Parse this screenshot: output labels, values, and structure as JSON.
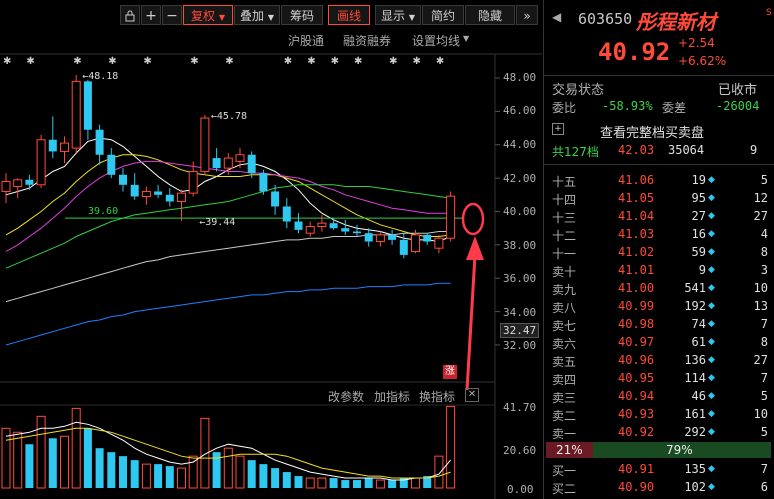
{
  "toolbar": {
    "buttons": [
      {
        "label": "复权",
        "active": true,
        "has_dropdown": true
      },
      {
        "label": "叠加",
        "active": false,
        "has_dropdown": true
      },
      {
        "label": "筹码",
        "active": false,
        "has_dropdown": false
      },
      {
        "label": "画线",
        "active": true,
        "has_dropdown": false
      },
      {
        "label": "显示",
        "active": false,
        "has_dropdown": true
      },
      {
        "label": "简约",
        "active": false,
        "has_dropdown": false
      },
      {
        "label": "隐藏",
        "active": false,
        "has_dropdown": false
      }
    ],
    "icons": [
      "lock-icon",
      "plus-icon",
      "minus-icon",
      "double-chevron-right-icon"
    ]
  },
  "sub_toolbar": {
    "links": [
      "沪股通",
      "融资融券",
      "设置均线"
    ]
  },
  "indicator_toolbar": {
    "links": [
      "改参数",
      "加指标",
      "换指标"
    ],
    "close_icon": "close-icon"
  },
  "chart_data": {
    "type": "candlestick",
    "y_axis_ticks": [
      "48.00",
      "46.00",
      "44.00",
      "42.00",
      "40.00",
      "38.00",
      "36.00",
      "34.00",
      "32.00"
    ],
    "current_price_tag": "32.47",
    "annotations": [
      {
        "text": "48.18",
        "x_index": 6,
        "value": 48.18
      },
      {
        "text": "45.78",
        "x_index": 17,
        "value": 45.78
      },
      {
        "text": "39.60",
        "x_index": 6,
        "value": 39.6
      },
      {
        "text": "39.44",
        "x_index": 16,
        "value": 39.44
      }
    ],
    "limit_up_badge": "涨",
    "horizontal_line_value": 39.6,
    "candles": [
      {
        "o": 41.2,
        "h": 42.3,
        "l": 40.5,
        "c": 41.8
      },
      {
        "o": 41.5,
        "h": 42.0,
        "l": 40.8,
        "c": 41.9
      },
      {
        "o": 41.9,
        "h": 42.2,
        "l": 41.3,
        "c": 41.6
      },
      {
        "o": 41.6,
        "h": 44.6,
        "l": 41.4,
        "c": 44.3
      },
      {
        "o": 44.3,
        "h": 45.7,
        "l": 43.2,
        "c": 43.6
      },
      {
        "o": 43.6,
        "h": 44.5,
        "l": 42.9,
        "c": 44.1
      },
      {
        "o": 43.8,
        "h": 48.18,
        "l": 43.5,
        "c": 47.8
      },
      {
        "o": 47.8,
        "h": 47.9,
        "l": 44.3,
        "c": 44.9
      },
      {
        "o": 44.9,
        "h": 45.2,
        "l": 42.8,
        "c": 43.4
      },
      {
        "o": 43.4,
        "h": 43.8,
        "l": 42.0,
        "c": 42.2
      },
      {
        "o": 42.2,
        "h": 42.6,
        "l": 41.2,
        "c": 41.6
      },
      {
        "o": 41.6,
        "h": 42.3,
        "l": 40.7,
        "c": 40.9
      },
      {
        "o": 40.9,
        "h": 41.5,
        "l": 40.4,
        "c": 41.2
      },
      {
        "o": 41.2,
        "h": 41.6,
        "l": 40.8,
        "c": 41.0
      },
      {
        "o": 41.0,
        "h": 41.4,
        "l": 40.3,
        "c": 40.6
      },
      {
        "o": 40.6,
        "h": 41.3,
        "l": 39.44,
        "c": 41.1
      },
      {
        "o": 41.1,
        "h": 43.0,
        "l": 40.9,
        "c": 42.4
      },
      {
        "o": 42.4,
        "h": 45.78,
        "l": 42.2,
        "c": 45.6
      },
      {
        "o": 43.2,
        "h": 43.8,
        "l": 42.4,
        "c": 42.6
      },
      {
        "o": 42.6,
        "h": 43.5,
        "l": 42.2,
        "c": 43.2
      },
      {
        "o": 43.0,
        "h": 43.8,
        "l": 42.6,
        "c": 43.4
      },
      {
        "o": 43.4,
        "h": 43.6,
        "l": 42.0,
        "c": 42.3
      },
      {
        "o": 42.3,
        "h": 42.5,
        "l": 41.0,
        "c": 41.2
      },
      {
        "o": 41.2,
        "h": 41.6,
        "l": 39.8,
        "c": 40.3
      },
      {
        "o": 40.3,
        "h": 40.8,
        "l": 39.0,
        "c": 39.4
      },
      {
        "o": 39.4,
        "h": 39.9,
        "l": 38.7,
        "c": 38.9
      },
      {
        "o": 38.7,
        "h": 39.4,
        "l": 38.5,
        "c": 39.1
      },
      {
        "o": 39.1,
        "h": 39.8,
        "l": 38.8,
        "c": 39.3
      },
      {
        "o": 39.3,
        "h": 39.6,
        "l": 38.9,
        "c": 39.0
      },
      {
        "o": 39.0,
        "h": 39.5,
        "l": 38.6,
        "c": 38.8
      },
      {
        "o": 38.8,
        "h": 39.2,
        "l": 38.5,
        "c": 38.7
      },
      {
        "o": 38.7,
        "h": 39.0,
        "l": 37.9,
        "c": 38.2
      },
      {
        "o": 38.2,
        "h": 38.8,
        "l": 37.9,
        "c": 38.6
      },
      {
        "o": 38.6,
        "h": 38.9,
        "l": 38.0,
        "c": 38.3
      },
      {
        "o": 38.3,
        "h": 38.7,
        "l": 37.2,
        "c": 37.4
      },
      {
        "o": 37.6,
        "h": 38.9,
        "l": 37.5,
        "c": 38.6
      },
      {
        "o": 38.6,
        "h": 38.7,
        "l": 38.0,
        "c": 38.2
      },
      {
        "o": 37.8,
        "h": 38.6,
        "l": 37.5,
        "c": 38.4
      },
      {
        "o": 38.4,
        "h": 41.2,
        "l": 38.2,
        "c": 40.92
      }
    ],
    "ma_series": [
      {
        "color": "#ffffff",
        "values": [
          41.0,
          41.2,
          41.4,
          41.9,
          42.4,
          42.7,
          43.5,
          44.2,
          44.4,
          44.3,
          43.9,
          43.3,
          42.7,
          42.1,
          41.6,
          41.2,
          41.3,
          41.8,
          42.1,
          42.5,
          42.8,
          42.9,
          42.7,
          42.4,
          41.9,
          41.3,
          40.5,
          39.9,
          39.5,
          39.2,
          39.0,
          38.9,
          38.8,
          38.6,
          38.4,
          38.3,
          38.3,
          38.2,
          38.5
        ]
      },
      {
        "color": "#f0e020",
        "values": [
          38.6,
          39.0,
          39.5,
          40.0,
          40.6,
          41.1,
          41.8,
          42.4,
          42.9,
          43.2,
          43.4,
          43.4,
          43.3,
          43.1,
          42.8,
          42.5,
          42.3,
          42.2,
          42.1,
          42.1,
          42.1,
          42.2,
          42.2,
          42.2,
          42.0,
          41.8,
          41.4,
          41.0,
          40.6,
          40.2,
          39.8,
          39.5,
          39.2,
          39.0,
          38.8,
          38.6,
          38.5,
          38.5,
          38.6
        ]
      },
      {
        "color": "#e040e0",
        "values": [
          37.6,
          38.0,
          38.5,
          39.0,
          39.6,
          40.2,
          40.9,
          41.5,
          42.0,
          42.4,
          42.7,
          42.9,
          43.0,
          43.0,
          42.9,
          42.8,
          42.7,
          42.6,
          42.5,
          42.4,
          42.4,
          42.3,
          42.3,
          42.2,
          42.1,
          42.0,
          41.8,
          41.5,
          41.3,
          41.0,
          40.8,
          40.6,
          40.4,
          40.2,
          40.1,
          40.0,
          39.9,
          39.9,
          39.9
        ]
      },
      {
        "color": "#30d040",
        "values": [
          36.6,
          36.9,
          37.2,
          37.5,
          37.8,
          38.1,
          38.5,
          38.8,
          39.1,
          39.4,
          39.6,
          39.8,
          39.9,
          40.0,
          40.1,
          40.2,
          40.3,
          40.4,
          40.5,
          40.6,
          40.8,
          41.0,
          41.2,
          41.4,
          41.5,
          41.6,
          41.6,
          41.6,
          41.6,
          41.5,
          41.5,
          41.5,
          41.4,
          41.3,
          41.2,
          41.1,
          41.0,
          40.9,
          40.8
        ]
      },
      {
        "color": "#c8c8c8",
        "values": [
          34.6,
          34.8,
          35.0,
          35.2,
          35.4,
          35.6,
          35.8,
          36.0,
          36.2,
          36.4,
          36.6,
          36.8,
          37.0,
          37.1,
          37.3,
          37.4,
          37.5,
          37.6,
          37.7,
          37.8,
          37.9,
          38.0,
          38.1,
          38.2,
          38.3,
          38.3,
          38.4,
          38.4,
          38.5,
          38.5,
          38.5,
          38.6,
          38.6,
          38.6,
          38.7,
          38.7,
          38.7,
          38.8,
          38.8
        ]
      },
      {
        "color": "#2080ff",
        "values": [
          32.0,
          32.2,
          32.4,
          32.6,
          32.8,
          33.0,
          33.2,
          33.4,
          33.5,
          33.7,
          33.8,
          34.0,
          34.1,
          34.2,
          34.3,
          34.4,
          34.5,
          34.6,
          34.7,
          34.8,
          34.9,
          35.0,
          35.0,
          35.1,
          35.2,
          35.2,
          35.3,
          35.3,
          35.4,
          35.4,
          35.4,
          35.5,
          35.5,
          35.5,
          35.6,
          35.6,
          35.6,
          35.7,
          35.7
        ]
      }
    ],
    "volume_axis_ticks": [
      "41.70",
      "20.60",
      "0.00"
    ],
    "volumes": [
      30,
      28,
      22,
      36,
      25,
      26,
      40,
      30,
      20,
      18,
      16,
      14,
      12,
      12,
      11,
      10,
      16,
      35,
      18,
      20,
      16,
      14,
      12,
      10,
      8,
      6,
      5,
      5,
      5,
      4,
      4,
      5,
      4,
      4,
      5,
      5,
      6,
      16,
      41
    ],
    "volume_ma": [
      {
        "color": "#ffffff",
        "values": [
          26,
          27,
          28,
          30,
          30,
          31,
          33,
          32,
          30,
          27,
          24,
          20,
          17,
          15,
          13,
          12,
          13,
          17,
          20,
          22,
          21,
          20,
          17,
          14,
          12,
          10,
          8,
          7,
          6,
          5,
          5,
          5,
          5,
          4,
          4,
          5,
          5,
          7,
          14
        ]
      },
      {
        "color": "#f0e020",
        "values": [
          24,
          25,
          26,
          27,
          28,
          29,
          30,
          30,
          29,
          28,
          26,
          24,
          22,
          20,
          18,
          16,
          15,
          15,
          15,
          16,
          17,
          17,
          17,
          17,
          16,
          14,
          12,
          10,
          9,
          8,
          7,
          6,
          6,
          5,
          5,
          5,
          5,
          6,
          8
        ]
      }
    ],
    "star_markers": [
      0,
      2,
      6,
      9,
      12,
      16,
      19,
      24,
      26,
      28,
      30,
      33,
      35,
      37
    ]
  },
  "right_panel": {
    "stock_code": "603650",
    "stock_name": "彤程新材",
    "s_badge": "S",
    "price": "40.92",
    "change": "+2.54",
    "change_pct": "+6.62%",
    "trading_status_label": "交易状态",
    "trading_status": "已收市",
    "wei_bi_label": "委比",
    "wei_bi": "-58.93%",
    "wei_cha_label": "委差",
    "wei_cha": "-26004",
    "full_orderbook_link": "查看完整档买卖盘",
    "total_levels_label": "共127档",
    "total_price": "42.03",
    "total_volume": "35064",
    "total_count": "9",
    "asks": [
      {
        "label": "十五",
        "price": "41.06",
        "vol": "19",
        "count": "5"
      },
      {
        "label": "十四",
        "price": "41.05",
        "vol": "95",
        "count": "12"
      },
      {
        "label": "十三",
        "price": "41.04",
        "vol": "27",
        "count": "27"
      },
      {
        "label": "十二",
        "price": "41.03",
        "vol": "16",
        "count": "4"
      },
      {
        "label": "十一",
        "price": "41.02",
        "vol": "59",
        "count": "8"
      },
      {
        "label": "卖十",
        "price": "41.01",
        "vol": "9",
        "count": "3"
      },
      {
        "label": "卖九",
        "price": "41.00",
        "vol": "541",
        "count": "10"
      },
      {
        "label": "卖八",
        "price": "40.99",
        "vol": "192",
        "count": "13"
      },
      {
        "label": "卖七",
        "price": "40.98",
        "vol": "74",
        "count": "7"
      },
      {
        "label": "卖六",
        "price": "40.97",
        "vol": "61",
        "count": "8"
      },
      {
        "label": "卖五",
        "price": "40.96",
        "vol": "136",
        "count": "27"
      },
      {
        "label": "卖四",
        "price": "40.95",
        "vol": "114",
        "count": "7"
      },
      {
        "label": "卖三",
        "price": "40.94",
        "vol": "46",
        "count": "5"
      },
      {
        "label": "卖二",
        "price": "40.93",
        "vol": "161",
        "count": "10"
      },
      {
        "label": "卖一",
        "price": "40.92",
        "vol": "292",
        "count": "5"
      }
    ],
    "buy_ratio": "21%",
    "sell_ratio": "79%",
    "buy_ratio_value": 0.21,
    "bids": [
      {
        "label": "买一",
        "price": "40.91",
        "vol": "135",
        "count": "7"
      },
      {
        "label": "买二",
        "price": "40.90",
        "vol": "102",
        "count": "6"
      }
    ]
  }
}
